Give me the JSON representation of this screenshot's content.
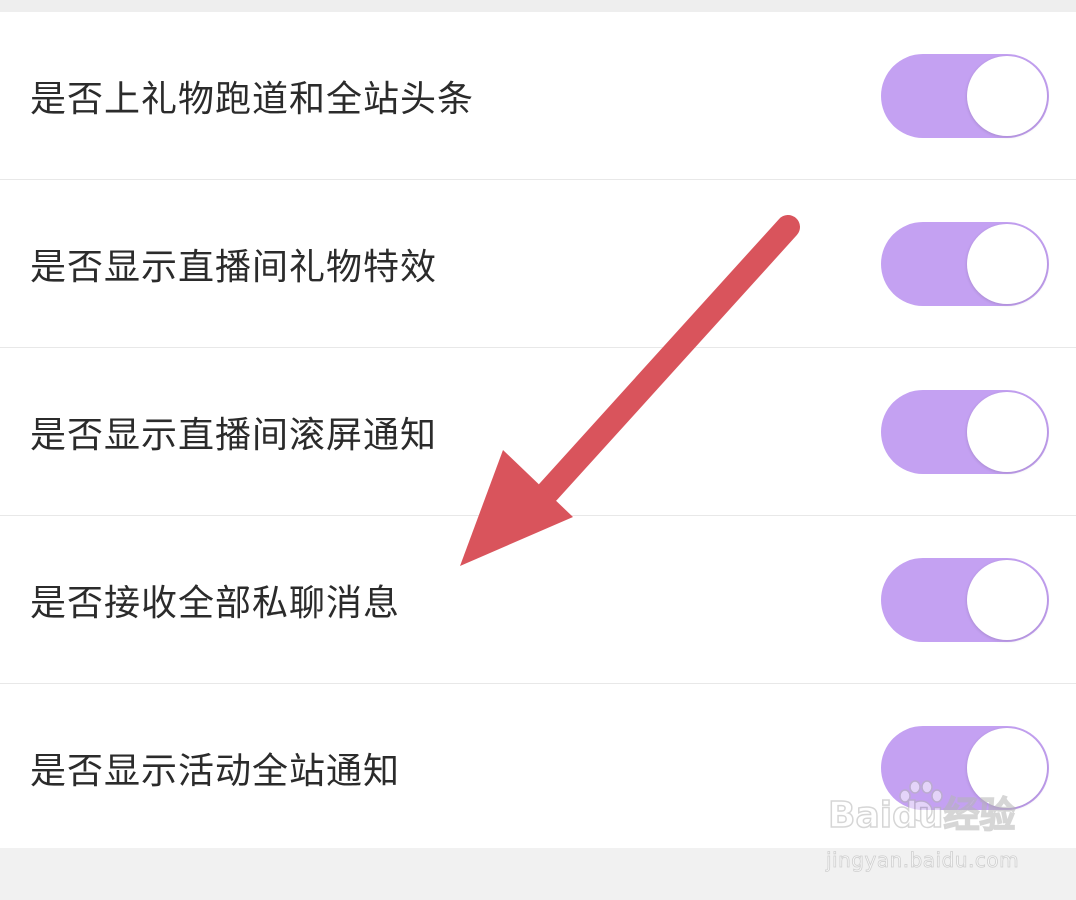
{
  "settings": {
    "items": [
      {
        "label": "是否上礼物跑道和全站头条",
        "enabled": true
      },
      {
        "label": "是否显示直播间礼物特效",
        "enabled": true
      },
      {
        "label": "是否显示直播间滚屏通知",
        "enabled": true
      },
      {
        "label": "是否接收全部私聊消息",
        "enabled": true
      },
      {
        "label": "是否显示活动全站通知",
        "enabled": true
      }
    ]
  },
  "colors": {
    "toggle_on": "#c4a1f2",
    "annotation_arrow": "#d9545c",
    "label_text": "#2b2b2b"
  },
  "watermark": {
    "logo_text": "Baidu经验",
    "url_text": "jingyan.baidu.com"
  }
}
